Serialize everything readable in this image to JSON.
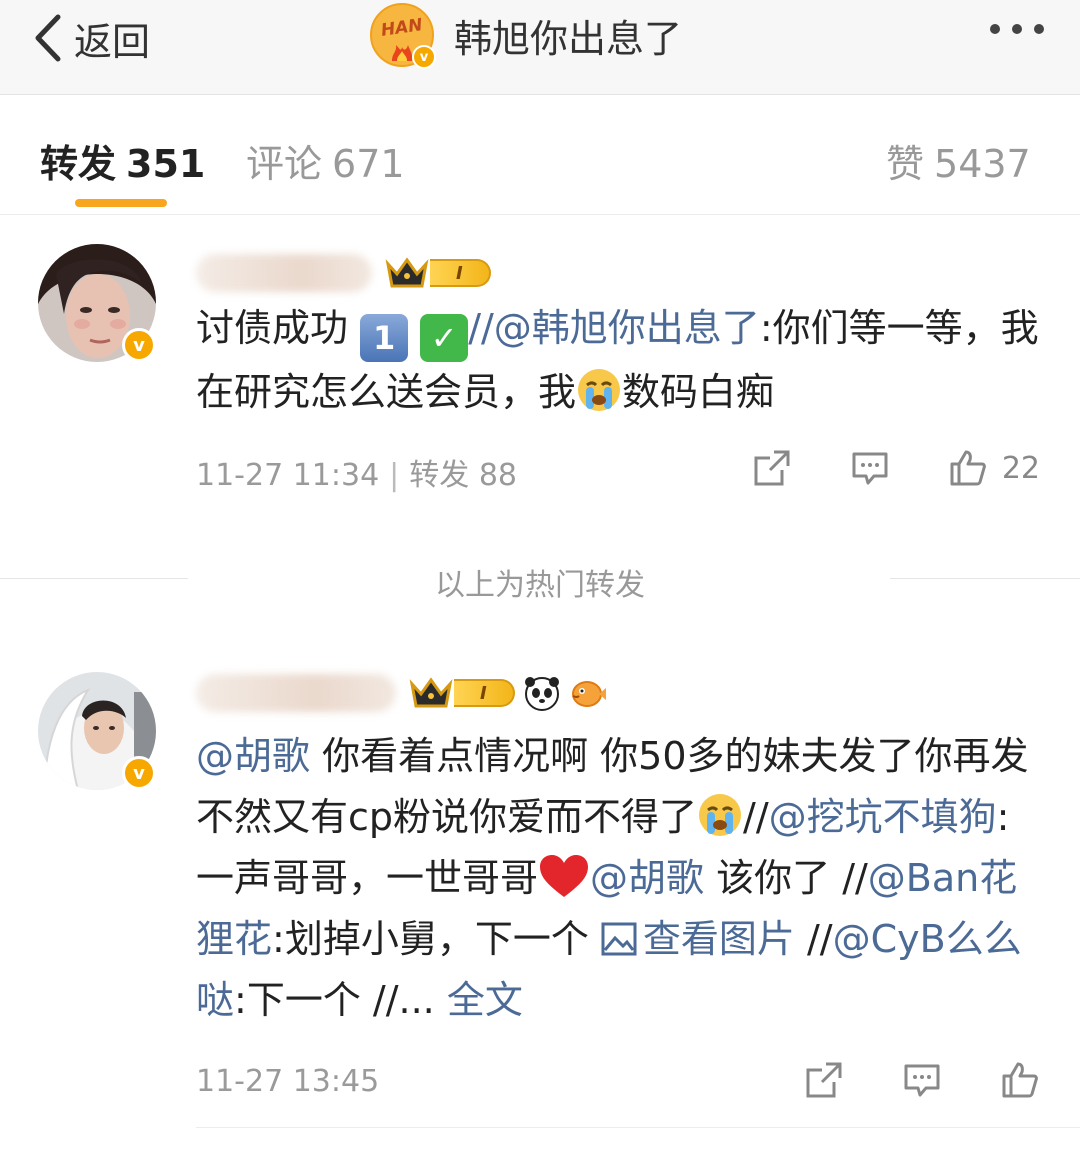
{
  "header": {
    "back_label": "返回",
    "title": "韩旭你出息了",
    "avatar_text": "HAN",
    "verified_mark": "v"
  },
  "tabs": [
    {
      "label": "转发",
      "count": "351"
    },
    {
      "label": "评论",
      "count": "671"
    },
    {
      "label": "赞",
      "count": "5437"
    }
  ],
  "posts": [
    {
      "verified_mark": "v",
      "level": "I",
      "content": {
        "t1": "讨债成功",
        "mention": "//@韩旭你出息了",
        "t2": ":你们等一等，我在研究怎么送会员，我",
        "t3": "数码白痴"
      },
      "time": "11-27 11:34",
      "repost_label": "转发",
      "repost_count": "88",
      "like_count": "22"
    },
    {
      "verified_mark": "v",
      "level": "I",
      "content": {
        "m1": "@胡歌",
        "t1": " 你看着点情况啊 你50多的妹夫发了你再发 不然又有cp粉说你爱而不得了",
        "t2": "//",
        "m2": "@挖坑不填狗",
        "t3": ":一声哥哥，一世哥哥",
        "m3": "@胡歌",
        "t4": " 该你了 //",
        "m4": "@Ban花狸花",
        "t5": ":划掉小舅，下一个 ",
        "pic_link": "查看图片",
        "t6": " //",
        "m5": "@CyB么么哒",
        "t7": ":下一个 //... ",
        "full_text": "全文"
      },
      "time": "11-27 13:45",
      "like_count": ""
    }
  ],
  "divider_text": "以上为热门转发",
  "colors": {
    "accent": "#f7a61e",
    "link": "#4b6a96",
    "verified": "#f7a800"
  }
}
